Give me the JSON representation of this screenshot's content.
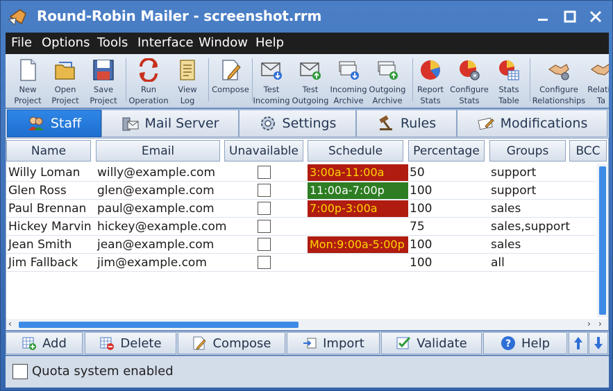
{
  "window": {
    "title": "Round-Robin Mailer - screenshot.rrm",
    "controls": [
      "minimize",
      "maximize",
      "close"
    ]
  },
  "menu": [
    "File",
    "Options",
    "Tools",
    "Interface",
    "Window",
    "Help"
  ],
  "toolbar": [
    {
      "label": "New\nProject",
      "icon": "new-project-icon"
    },
    {
      "label": "Open\nProject",
      "icon": "open-project-icon"
    },
    {
      "label": "Save\nProject",
      "icon": "save-project-icon"
    },
    {
      "label": "Run\nOperation",
      "icon": "run-operation-icon"
    },
    {
      "label": "View\nLog",
      "icon": "view-log-icon"
    },
    {
      "label": "Compose",
      "icon": "compose-icon"
    },
    {
      "label": "Test\nIncoming",
      "icon": "test-incoming-icon"
    },
    {
      "label": "Test\nOutgoing",
      "icon": "test-outgoing-icon"
    },
    {
      "label": "Incoming\nArchive",
      "icon": "incoming-archive-icon"
    },
    {
      "label": "Outgoing\nArchive",
      "icon": "outgoing-archive-icon"
    },
    {
      "label": "Report\nStats",
      "icon": "report-stats-icon"
    },
    {
      "label": "Configure\nStats",
      "icon": "configure-stats-icon"
    },
    {
      "label": "Stats\nTable",
      "icon": "stats-table-icon"
    },
    {
      "label": "Configure\nRelationships",
      "icon": "configure-relationships-icon"
    },
    {
      "label": "Relatio\nTa",
      "icon": "relationships-table-icon"
    }
  ],
  "tabs": [
    {
      "label": "Staff",
      "active": true,
      "icon": "staff-icon"
    },
    {
      "label": "Mail Server",
      "active": false,
      "icon": "mail-server-icon"
    },
    {
      "label": "Settings",
      "active": false,
      "icon": "settings-icon"
    },
    {
      "label": "Rules",
      "active": false,
      "icon": "rules-icon"
    },
    {
      "label": "Modifications",
      "active": false,
      "icon": "modifications-icon"
    }
  ],
  "columns": [
    "Name",
    "Email",
    "Unavailable",
    "Schedule",
    "Percentage",
    "Groups",
    "BCC"
  ],
  "rows": [
    {
      "name": "Willy Loman",
      "email": "willy@example.com",
      "unavailable": false,
      "schedule": "3:00a-11:00a",
      "schedule_color": "red",
      "percentage": "50",
      "groups": "support"
    },
    {
      "name": "Glen Ross",
      "email": "glen@example.com",
      "unavailable": false,
      "schedule": "11:00a-7:00p",
      "schedule_color": "green",
      "percentage": "100",
      "groups": "support"
    },
    {
      "name": "Paul Brennan",
      "email": "paul@example.com",
      "unavailable": false,
      "schedule": "7:00p-3:00a",
      "schedule_color": "red",
      "percentage": "100",
      "groups": "sales"
    },
    {
      "name": "Hickey Marvin",
      "email": "hickey@example.com",
      "unavailable": false,
      "schedule": "",
      "schedule_color": "",
      "percentage": "75",
      "groups": "sales,support"
    },
    {
      "name": "Jean Smith",
      "email": "jean@example.com",
      "unavailable": false,
      "schedule": "Mon:9:00a-5:00p",
      "schedule_color": "red",
      "percentage": "100",
      "groups": "sales"
    },
    {
      "name": "Jim Fallback",
      "email": "jim@example.com",
      "unavailable": false,
      "schedule": "",
      "schedule_color": "",
      "percentage": "100",
      "groups": "all"
    }
  ],
  "actions": [
    {
      "label": "Add",
      "icon": "add-icon"
    },
    {
      "label": "Delete",
      "icon": "delete-icon"
    },
    {
      "label": "Compose",
      "icon": "compose-icon"
    },
    {
      "label": "Import",
      "icon": "import-icon"
    },
    {
      "label": "Validate",
      "icon": "validate-icon"
    },
    {
      "label": "Help",
      "icon": "help-icon"
    }
  ],
  "quota": {
    "label": "Quota system enabled",
    "checked": false
  },
  "colors": {
    "schedule_red": "#b01c10",
    "schedule_green": "#2e7d23",
    "schedule_red_text": "#ffd500",
    "active_tab": "#1e6fd0"
  }
}
